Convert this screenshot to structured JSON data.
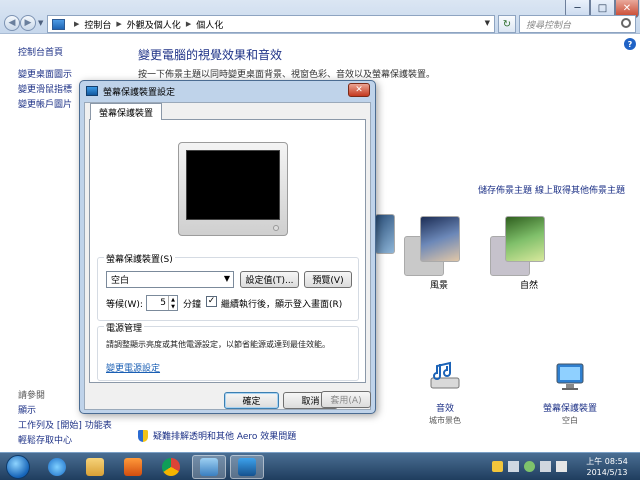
{
  "explorer": {
    "breadcrumb": [
      "控制台",
      "外觀及個人化",
      "個人化"
    ],
    "search_placeholder": "搜尋控制台",
    "window_buttons": {
      "minimize": "─",
      "maximize": "□",
      "close": "✕"
    }
  },
  "left_pane": {
    "home": "控制台首頁",
    "links": [
      "變更桌面圖示",
      "變更滑鼠指標",
      "變更帳戶圖片"
    ],
    "see_also_title": "請參閱",
    "see_also": [
      "顯示",
      "工作列及 [開始] 功能表",
      "輕鬆存取中心"
    ]
  },
  "main": {
    "title": "變更電腦的視覺效果和音效",
    "description": "按一下佈景主題以同時變更桌面背景、視窗色彩、音效以及螢幕保護裝置。",
    "help": "?",
    "theme_links": [
      "儲存佈景主題",
      "線上取得其他佈景主題"
    ],
    "themes": [
      {
        "label": "風景",
        "color": "#8fb6d8"
      },
      {
        "label": "自然",
        "color": "#7fbf6a"
      }
    ],
    "bottom_items": [
      {
        "title": "音效",
        "subtitle": "城市景色"
      },
      {
        "title": "螢幕保護裝置",
        "subtitle": "空白"
      }
    ],
    "troubleshoot": "疑難排解透明和其他 Aero 效果問題"
  },
  "dialog": {
    "title": "螢幕保護裝置設定",
    "close": "✕",
    "tab": "螢幕保護裝置",
    "screensaver_group": "螢幕保護裝置(S)",
    "screensaver_value": "空白",
    "settings_button": "設定值(T)...",
    "preview_button": "預覽(V)",
    "wait_label": "等候(W):",
    "wait_value": "5",
    "wait_unit": "分鐘",
    "resume_label": "繼續執行後，顯示登入畫面(R)",
    "resume_checked": "✓",
    "power_group": "電源管理",
    "power_desc": "請調整顯示亮度或其他電源設定，以節省能源或達到最佳效能。",
    "power_link": "變更電源設定",
    "ok": "確定",
    "cancel": "取消",
    "apply": "套用(A)"
  },
  "taskbar": {
    "clock_time": "上午 08:54",
    "clock_date": "2014/5/13"
  }
}
